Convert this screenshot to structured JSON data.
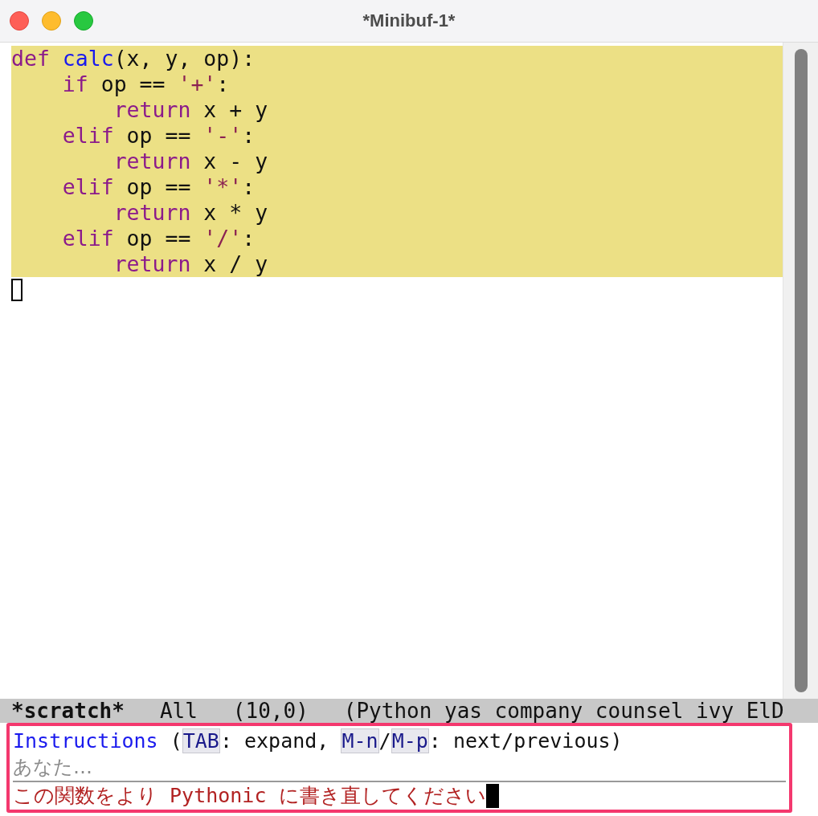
{
  "window": {
    "title": "*Minibuf-1*"
  },
  "editor": {
    "lines": [
      {
        "highlighted": true,
        "segments": [
          {
            "kind": "keyword",
            "text": "def "
          },
          {
            "kind": "function",
            "text": "calc"
          },
          {
            "kind": "plain",
            "text": "(x, y, op):"
          }
        ]
      },
      {
        "highlighted": true,
        "segments": [
          {
            "kind": "keyword",
            "text": "    if"
          },
          {
            "kind": "plain",
            "text": " op == "
          },
          {
            "kind": "string",
            "text": "'+'"
          },
          {
            "kind": "plain",
            "text": ":"
          }
        ]
      },
      {
        "highlighted": true,
        "segments": [
          {
            "kind": "keyword",
            "text": "        return"
          },
          {
            "kind": "plain",
            "text": " x + y"
          }
        ]
      },
      {
        "highlighted": true,
        "segments": [
          {
            "kind": "keyword",
            "text": "    elif"
          },
          {
            "kind": "plain",
            "text": " op == "
          },
          {
            "kind": "string",
            "text": "'-'"
          },
          {
            "kind": "plain",
            "text": ":"
          }
        ]
      },
      {
        "highlighted": true,
        "segments": [
          {
            "kind": "keyword",
            "text": "        return"
          },
          {
            "kind": "plain",
            "text": " x - y"
          }
        ]
      },
      {
        "highlighted": true,
        "segments": [
          {
            "kind": "keyword",
            "text": "    elif"
          },
          {
            "kind": "plain",
            "text": " op == "
          },
          {
            "kind": "string",
            "text": "'*'"
          },
          {
            "kind": "plain",
            "text": ":"
          }
        ]
      },
      {
        "highlighted": true,
        "segments": [
          {
            "kind": "keyword",
            "text": "        return"
          },
          {
            "kind": "plain",
            "text": " x * y"
          }
        ]
      },
      {
        "highlighted": true,
        "segments": [
          {
            "kind": "keyword",
            "text": "    elif"
          },
          {
            "kind": "plain",
            "text": " op == "
          },
          {
            "kind": "string",
            "text": "'/'"
          },
          {
            "kind": "plain",
            "text": ":"
          }
        ]
      },
      {
        "highlighted": true,
        "segments": [
          {
            "kind": "keyword",
            "text": "        return"
          },
          {
            "kind": "plain",
            "text": " x / y"
          }
        ]
      }
    ]
  },
  "mode_line": {
    "buffer": "*scratch*",
    "position": "All",
    "line_col": "(10,0)",
    "modes": "(Python yas company counsel ivy ElD"
  },
  "minibuffer": {
    "prompt": [
      {
        "kind": "label",
        "text": "Instructions"
      },
      {
        "kind": "plain",
        "text": " ("
      },
      {
        "kind": "key",
        "text": "TAB"
      },
      {
        "kind": "plain",
        "text": ": expand, "
      },
      {
        "kind": "key",
        "text": "M-n"
      },
      {
        "kind": "plain",
        "text": "/"
      },
      {
        "kind": "key",
        "text": "M-p"
      },
      {
        "kind": "plain",
        "text": ": next/previous)"
      }
    ],
    "placeholder": "あなた…",
    "input": "この関数をより Pythonic に書き直してください"
  }
}
